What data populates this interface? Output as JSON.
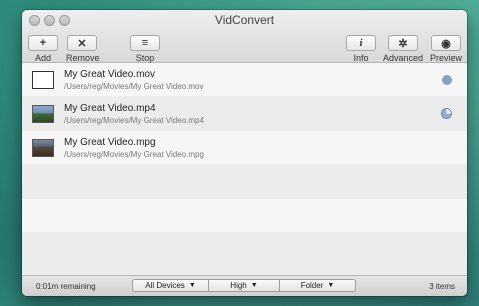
{
  "window": {
    "title": "VidConvert"
  },
  "toolbar": {
    "add": {
      "icon": "+",
      "label": "Add"
    },
    "remove": {
      "icon": "✕",
      "label": "Remove"
    },
    "stop": {
      "icon": "≡",
      "label": "Stop"
    },
    "info": {
      "icon": "i",
      "label": "Info"
    },
    "advanced": {
      "icon": "✲",
      "label": "Advanced"
    },
    "preview": {
      "icon": "◉",
      "label": "Preview"
    }
  },
  "files": [
    {
      "name": "My Great Video.mov",
      "path": "/Users/reg/Movies/My Great Video.mov",
      "status": "queued"
    },
    {
      "name": "My Great Video.mp4",
      "path": "/Users/reg/Movies/My Great Video.mp4",
      "status": "in-progress"
    },
    {
      "name": "My Great Video.mpg",
      "path": "/Users/reg/Movies/My Great Video.mpg",
      "status": "none"
    }
  ],
  "footer": {
    "remaining": "0:01m remaining",
    "devices": "All Devices",
    "quality": "High",
    "destination": "Folder",
    "item_count": "3 items",
    "arrow": "▼"
  }
}
